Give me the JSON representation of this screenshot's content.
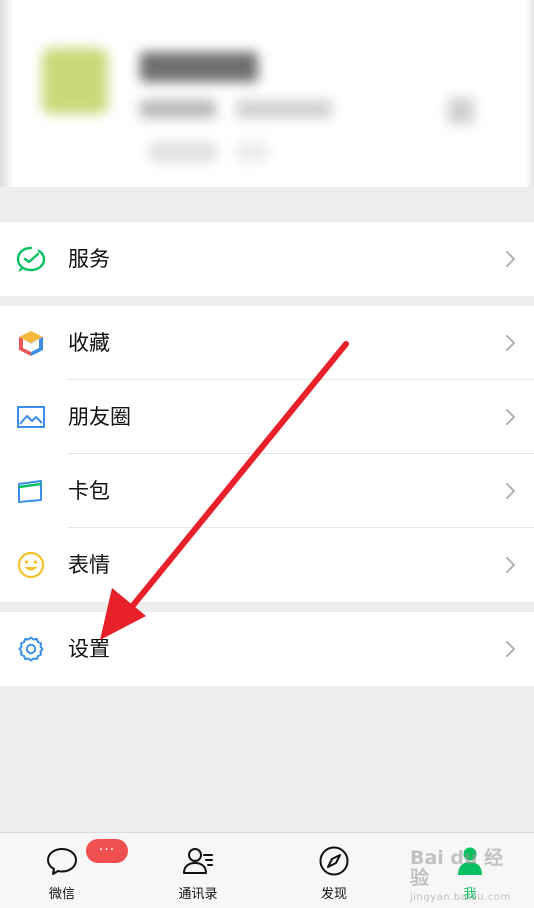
{
  "profile": {},
  "menu": {
    "services": {
      "label": "服务",
      "icon": "wechat-pay-icon"
    },
    "favorites": {
      "label": "收藏",
      "icon": "cube-icon"
    },
    "moments": {
      "label": "朋友圈",
      "icon": "picture-icon"
    },
    "cards": {
      "label": "卡包",
      "icon": "card-icon"
    },
    "stickers": {
      "label": "表情",
      "icon": "smiley-icon"
    },
    "settings": {
      "label": "设置",
      "icon": "gear-icon"
    }
  },
  "tabbar": {
    "chats": {
      "label": "微信",
      "badge": "···"
    },
    "contacts": {
      "label": "通讯录"
    },
    "discover": {
      "label": "发现"
    },
    "me": {
      "label": "我",
      "active": true
    }
  },
  "colors": {
    "accent_green": "#07c160",
    "badge_red": "#f04f4f",
    "annotation_red": "#e8202a"
  },
  "watermark": {
    "main": "Bai du 经验",
    "sub": "jingyan.baidu.com"
  }
}
